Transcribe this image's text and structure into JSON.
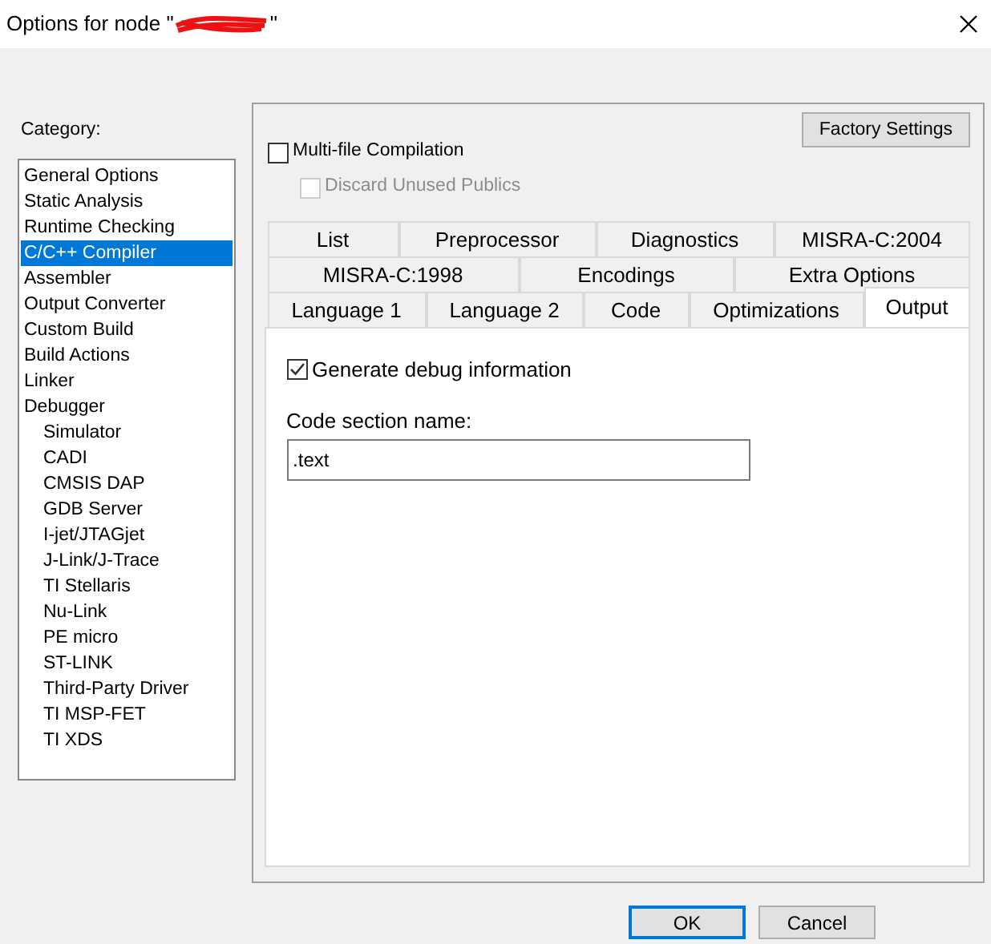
{
  "window": {
    "title_prefix": "Options for node \"",
    "title_suffix": "\"",
    "redacted": true
  },
  "category": {
    "label": "Category:",
    "items": [
      {
        "label": "General Options",
        "selected": false
      },
      {
        "label": "Static Analysis",
        "selected": false
      },
      {
        "label": "Runtime Checking",
        "selected": false
      },
      {
        "label": "C/C++ Compiler",
        "selected": true
      },
      {
        "label": "Assembler",
        "selected": false
      },
      {
        "label": "Output Converter",
        "selected": false
      },
      {
        "label": "Custom Build",
        "selected": false
      },
      {
        "label": "Build Actions",
        "selected": false
      },
      {
        "label": "Linker",
        "selected": false
      },
      {
        "label": "Debugger",
        "selected": false,
        "children": [
          {
            "label": "Simulator",
            "selected": false
          },
          {
            "label": "CADI",
            "selected": false
          },
          {
            "label": "CMSIS DAP",
            "selected": false
          },
          {
            "label": "GDB Server",
            "selected": false
          },
          {
            "label": "I-jet/JTAGjet",
            "selected": false
          },
          {
            "label": "J-Link/J-Trace",
            "selected": false
          },
          {
            "label": "TI Stellaris",
            "selected": false
          },
          {
            "label": "Nu-Link",
            "selected": false
          },
          {
            "label": "PE micro",
            "selected": false
          },
          {
            "label": "ST-LINK",
            "selected": false
          },
          {
            "label": "Third-Party Driver",
            "selected": false
          },
          {
            "label": "TI MSP-FET",
            "selected": false
          },
          {
            "label": "TI XDS",
            "selected": false
          }
        ]
      }
    ]
  },
  "factory_button": "Factory Settings",
  "options": [
    {
      "label": "Multi-file Compilation",
      "checked": false,
      "disabled": false,
      "indented": false
    },
    {
      "label": "Discard Unused Publics",
      "checked": false,
      "disabled": true,
      "indented": true
    }
  ],
  "tab_rows": [
    [
      {
        "label": "List",
        "selected": false
      },
      {
        "label": "Preprocessor",
        "selected": false
      },
      {
        "label": "Diagnostics",
        "selected": false
      },
      {
        "label": "MISRA-C:2004",
        "selected": false
      }
    ],
    [
      {
        "label": "MISRA-C:1998",
        "selected": false
      },
      {
        "label": "Encodings",
        "selected": false
      },
      {
        "label": "Extra Options",
        "selected": false
      }
    ],
    [
      {
        "label": "Language 1",
        "selected": false
      },
      {
        "label": "Language 2",
        "selected": false
      },
      {
        "label": "Code",
        "selected": false
      },
      {
        "label": "Optimizations",
        "selected": false
      },
      {
        "label": "Output",
        "selected": true
      }
    ]
  ],
  "output_page": {
    "debug": {
      "label": "Generate debug information",
      "checked": true
    },
    "section_label": "Code section name:",
    "section_value": ".text"
  },
  "buttons": [
    {
      "label": "OK",
      "default": true
    },
    {
      "label": "Cancel",
      "default": false
    }
  ]
}
